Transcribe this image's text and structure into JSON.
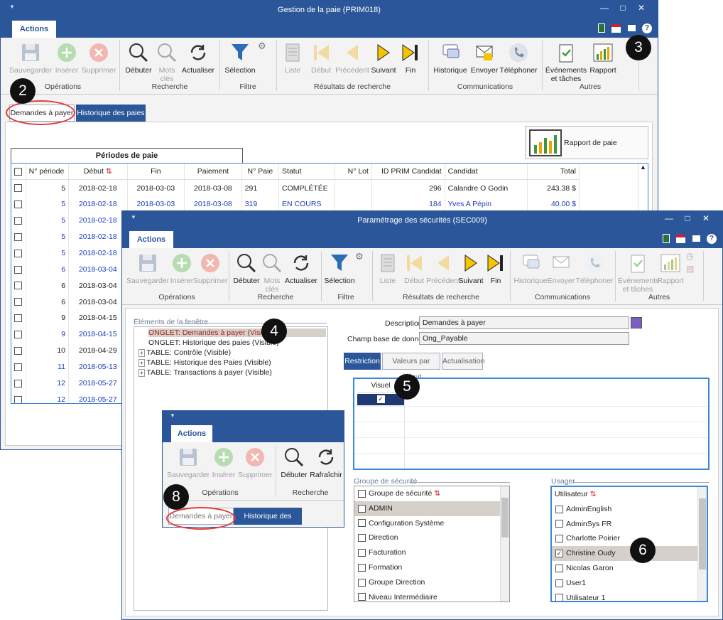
{
  "colors": {
    "accent": "#2b579a",
    "highlight_ring": "#e23a3a",
    "link_blue": "#1a3bbf"
  },
  "main": {
    "title": "Gestion de la paie (PRIM018)",
    "actions_tab": "Actions",
    "ribbon": {
      "save": "Sauvegarder",
      "insert": "Insérer",
      "delete": "Supprimer",
      "g_ops": "Opérations",
      "start": "Débuter",
      "keywords_1": "Mots",
      "keywords_2": "clés",
      "refresh": "Actualiser",
      "g_search": "Recherche",
      "selection": "Sélection",
      "g_filter": "Filtre",
      "list": "Liste",
      "first": "Début",
      "prev": "Précédent",
      "next": "Suivant",
      "last": "Fin",
      "g_results": "Résultats de recherche",
      "history": "Historique",
      "send": "Envoyer",
      "phone": "Téléphoner",
      "g_comm": "Communications",
      "events_1": "Événements",
      "events_2": "et tâches",
      "report": "Rapport",
      "g_other": "Autres"
    },
    "tabs": [
      "Demandes à payer",
      "Historique des paies"
    ],
    "report_button": "Rapport de paie",
    "periods_title": "Périodes de paie",
    "columns": [
      "N° période",
      "Début",
      "Fin",
      "Paiement",
      "N° Paie",
      "Statut",
      "N° Lot",
      "ID PRIM Candidat",
      "Candidat",
      "Total"
    ],
    "rows": [
      {
        "period": "5",
        "start": "2018-02-18",
        "end": "2018-03-03",
        "pay": "2018-03-08",
        "num": "291",
        "status": "COMPLÉTÉE",
        "lot": "",
        "id": "296",
        "cand": "Calandre O Godin",
        "total": "243.38 $",
        "blue": false
      },
      {
        "period": "5",
        "start": "2018-02-18",
        "end": "2018-03-03",
        "pay": "2018-03-08",
        "num": "319",
        "status": "EN COURS",
        "lot": "",
        "id": "184",
        "cand": "Yves A Pépin",
        "total": "40.00 $",
        "blue": true
      },
      {
        "period": "5",
        "start": "2018-02-18",
        "blue": true
      },
      {
        "period": "5",
        "start": "2018-02-18",
        "blue": true
      },
      {
        "period": "5",
        "start": "2018-02-18",
        "blue": true
      },
      {
        "period": "6",
        "start": "2018-03-04",
        "blue": true
      },
      {
        "period": "6",
        "start": "2018-03-04",
        "blue": false
      },
      {
        "period": "6",
        "start": "2018-03-04",
        "blue": false
      },
      {
        "period": "9",
        "start": "2018-04-15",
        "blue": false
      },
      {
        "period": "9",
        "start": "2018-04-15",
        "blue": true
      },
      {
        "period": "10",
        "start": "2018-04-29",
        "blue": false
      },
      {
        "period": "11",
        "start": "2018-05-13",
        "blue": true
      },
      {
        "period": "12",
        "start": "2018-05-27",
        "blue": true
      },
      {
        "period": "12",
        "start": "2018-05-27",
        "blue": true
      }
    ]
  },
  "sec": {
    "title": "Paramétrage des sécurités (SEC009)",
    "actions_tab": "Actions",
    "ribbon": {
      "save": "Sauvegarder",
      "insert": "Insérer",
      "delete": "Supprimer",
      "g_ops": "Opérations",
      "start": "Débuter",
      "keywords_1": "Mots",
      "keywords_2": "clés",
      "refresh": "Actualiser",
      "g_search": "Recherche",
      "selection": "Sélection",
      "g_filter": "Filtre",
      "list": "Liste",
      "first": "Début",
      "prev": "Précédent",
      "next": "Suivant",
      "last": "Fin",
      "g_results": "Résultats de recherche",
      "history": "Historique",
      "send": "Envoyer",
      "phone": "Téléphoner",
      "g_comm": "Communications",
      "events_1": "Événements",
      "events_2": "et tâches",
      "report": "Rapport",
      "g_other": "Autres"
    },
    "elements_title": "Éléments de la fenêtre",
    "tree": [
      "ONGLET: Demandes à payer (Visible)",
      "ONGLET: Historique des paies (Visible)",
      "TABLE: Contrôle (Visible)",
      "TABLE: Historique des Paies (Visible)",
      "TABLE: Transactions à payer (Visible)"
    ],
    "desc_label": "Description",
    "desc_value": "Demandes à payer",
    "db_label": "Champ base de données",
    "db_value": "Ong_Payable",
    "subtabs": [
      "Restriction",
      "Valeurs par défaut",
      "Actualisation"
    ],
    "visual_header": "Visuel",
    "group_title": "Groupe de sécurité",
    "group_header": "Groupe de sécurité",
    "groups": [
      "ADMIN",
      "Configuration Système",
      "Direction",
      "Facturation",
      "Formation",
      "Groupe Direction",
      "Niveau Intermédiaire"
    ],
    "user_title": "Usager",
    "user_header": "Utilisateur",
    "users": [
      "AdminEnglish",
      "AdminSys FR",
      "Charlotte Poirier",
      "Christine Oudy",
      "Nicolas Garon",
      "User1",
      "Utilisateur 1"
    ]
  },
  "mini": {
    "actions_tab": "Actions",
    "save": "Sauvegarder",
    "insert": "Insérer",
    "delete": "Supprimer",
    "g_ops": "Opérations",
    "start": "Débuter",
    "refresh": "Rafraîchir",
    "g_search": "Recherche",
    "tabs": [
      "Demandes à payer",
      "Historique des paies"
    ]
  },
  "badges": [
    "2",
    "3",
    "4",
    "5",
    "6",
    "8"
  ]
}
